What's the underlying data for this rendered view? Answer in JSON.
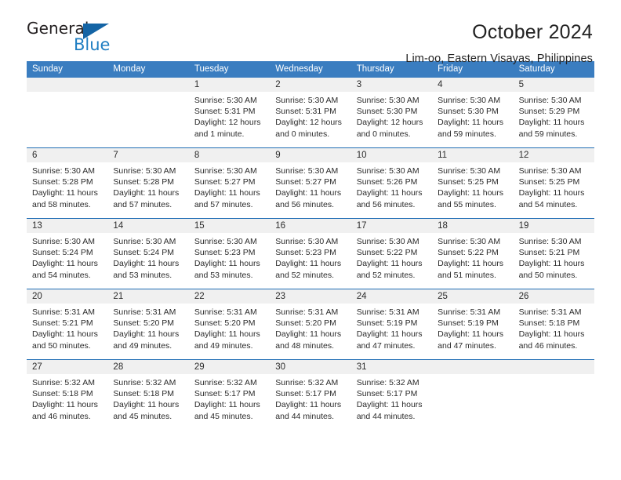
{
  "logo": {
    "word_one": "General",
    "word_two": "Blue",
    "triangle_icon": "triangle-icon",
    "accent_color": "#1f7ec2"
  },
  "header": {
    "title": "October 2024",
    "subtitle": "Lim-oo, Eastern Visayas, Philippines"
  },
  "calendar": {
    "header_bg": "#3a7dc0",
    "separator_color": "#1f6db5",
    "daynum_bg": "#f0f0f0",
    "weekdays": [
      "Sunday",
      "Monday",
      "Tuesday",
      "Wednesday",
      "Thursday",
      "Friday",
      "Saturday"
    ],
    "weeks": [
      [
        {
          "day": "",
          "lines": []
        },
        {
          "day": "",
          "lines": []
        },
        {
          "day": "1",
          "lines": [
            "Sunrise: 5:30 AM",
            "Sunset: 5:31 PM",
            "Daylight: 12 hours",
            "and 1 minute."
          ]
        },
        {
          "day": "2",
          "lines": [
            "Sunrise: 5:30 AM",
            "Sunset: 5:31 PM",
            "Daylight: 12 hours",
            "and 0 minutes."
          ]
        },
        {
          "day": "3",
          "lines": [
            "Sunrise: 5:30 AM",
            "Sunset: 5:30 PM",
            "Daylight: 12 hours",
            "and 0 minutes."
          ]
        },
        {
          "day": "4",
          "lines": [
            "Sunrise: 5:30 AM",
            "Sunset: 5:30 PM",
            "Daylight: 11 hours",
            "and 59 minutes."
          ]
        },
        {
          "day": "5",
          "lines": [
            "Sunrise: 5:30 AM",
            "Sunset: 5:29 PM",
            "Daylight: 11 hours",
            "and 59 minutes."
          ]
        }
      ],
      [
        {
          "day": "6",
          "lines": [
            "Sunrise: 5:30 AM",
            "Sunset: 5:28 PM",
            "Daylight: 11 hours",
            "and 58 minutes."
          ]
        },
        {
          "day": "7",
          "lines": [
            "Sunrise: 5:30 AM",
            "Sunset: 5:28 PM",
            "Daylight: 11 hours",
            "and 57 minutes."
          ]
        },
        {
          "day": "8",
          "lines": [
            "Sunrise: 5:30 AM",
            "Sunset: 5:27 PM",
            "Daylight: 11 hours",
            "and 57 minutes."
          ]
        },
        {
          "day": "9",
          "lines": [
            "Sunrise: 5:30 AM",
            "Sunset: 5:27 PM",
            "Daylight: 11 hours",
            "and 56 minutes."
          ]
        },
        {
          "day": "10",
          "lines": [
            "Sunrise: 5:30 AM",
            "Sunset: 5:26 PM",
            "Daylight: 11 hours",
            "and 56 minutes."
          ]
        },
        {
          "day": "11",
          "lines": [
            "Sunrise: 5:30 AM",
            "Sunset: 5:25 PM",
            "Daylight: 11 hours",
            "and 55 minutes."
          ]
        },
        {
          "day": "12",
          "lines": [
            "Sunrise: 5:30 AM",
            "Sunset: 5:25 PM",
            "Daylight: 11 hours",
            "and 54 minutes."
          ]
        }
      ],
      [
        {
          "day": "13",
          "lines": [
            "Sunrise: 5:30 AM",
            "Sunset: 5:24 PM",
            "Daylight: 11 hours",
            "and 54 minutes."
          ]
        },
        {
          "day": "14",
          "lines": [
            "Sunrise: 5:30 AM",
            "Sunset: 5:24 PM",
            "Daylight: 11 hours",
            "and 53 minutes."
          ]
        },
        {
          "day": "15",
          "lines": [
            "Sunrise: 5:30 AM",
            "Sunset: 5:23 PM",
            "Daylight: 11 hours",
            "and 53 minutes."
          ]
        },
        {
          "day": "16",
          "lines": [
            "Sunrise: 5:30 AM",
            "Sunset: 5:23 PM",
            "Daylight: 11 hours",
            "and 52 minutes."
          ]
        },
        {
          "day": "17",
          "lines": [
            "Sunrise: 5:30 AM",
            "Sunset: 5:22 PM",
            "Daylight: 11 hours",
            "and 52 minutes."
          ]
        },
        {
          "day": "18",
          "lines": [
            "Sunrise: 5:30 AM",
            "Sunset: 5:22 PM",
            "Daylight: 11 hours",
            "and 51 minutes."
          ]
        },
        {
          "day": "19",
          "lines": [
            "Sunrise: 5:30 AM",
            "Sunset: 5:21 PM",
            "Daylight: 11 hours",
            "and 50 minutes."
          ]
        }
      ],
      [
        {
          "day": "20",
          "lines": [
            "Sunrise: 5:31 AM",
            "Sunset: 5:21 PM",
            "Daylight: 11 hours",
            "and 50 minutes."
          ]
        },
        {
          "day": "21",
          "lines": [
            "Sunrise: 5:31 AM",
            "Sunset: 5:20 PM",
            "Daylight: 11 hours",
            "and 49 minutes."
          ]
        },
        {
          "day": "22",
          "lines": [
            "Sunrise: 5:31 AM",
            "Sunset: 5:20 PM",
            "Daylight: 11 hours",
            "and 49 minutes."
          ]
        },
        {
          "day": "23",
          "lines": [
            "Sunrise: 5:31 AM",
            "Sunset: 5:20 PM",
            "Daylight: 11 hours",
            "and 48 minutes."
          ]
        },
        {
          "day": "24",
          "lines": [
            "Sunrise: 5:31 AM",
            "Sunset: 5:19 PM",
            "Daylight: 11 hours",
            "and 47 minutes."
          ]
        },
        {
          "day": "25",
          "lines": [
            "Sunrise: 5:31 AM",
            "Sunset: 5:19 PM",
            "Daylight: 11 hours",
            "and 47 minutes."
          ]
        },
        {
          "day": "26",
          "lines": [
            "Sunrise: 5:31 AM",
            "Sunset: 5:18 PM",
            "Daylight: 11 hours",
            "and 46 minutes."
          ]
        }
      ],
      [
        {
          "day": "27",
          "lines": [
            "Sunrise: 5:32 AM",
            "Sunset: 5:18 PM",
            "Daylight: 11 hours",
            "and 46 minutes."
          ]
        },
        {
          "day": "28",
          "lines": [
            "Sunrise: 5:32 AM",
            "Sunset: 5:18 PM",
            "Daylight: 11 hours",
            "and 45 minutes."
          ]
        },
        {
          "day": "29",
          "lines": [
            "Sunrise: 5:32 AM",
            "Sunset: 5:17 PM",
            "Daylight: 11 hours",
            "and 45 minutes."
          ]
        },
        {
          "day": "30",
          "lines": [
            "Sunrise: 5:32 AM",
            "Sunset: 5:17 PM",
            "Daylight: 11 hours",
            "and 44 minutes."
          ]
        },
        {
          "day": "31",
          "lines": [
            "Sunrise: 5:32 AM",
            "Sunset: 5:17 PM",
            "Daylight: 11 hours",
            "and 44 minutes."
          ]
        },
        {
          "day": "",
          "lines": []
        },
        {
          "day": "",
          "lines": []
        }
      ]
    ]
  }
}
